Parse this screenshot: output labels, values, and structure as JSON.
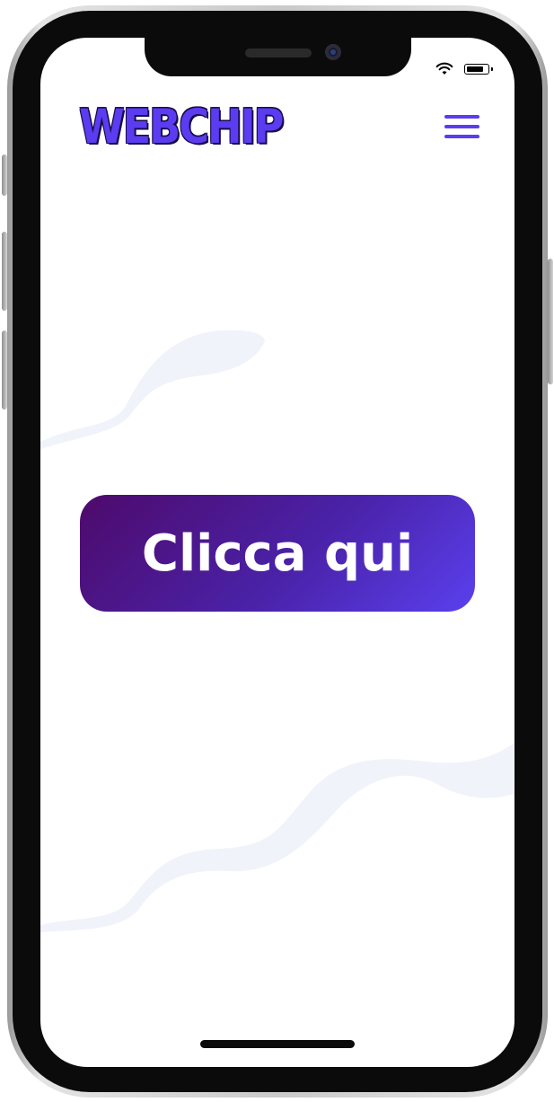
{
  "header": {
    "logo_text": "WEBCHIP"
  },
  "main": {
    "cta_label": "Clicca qui"
  },
  "status_bar": {
    "icons": [
      "wifi-icon",
      "battery-icon"
    ]
  },
  "colors": {
    "brand": "#5b3cf0",
    "button_gradient_start": "#4e0a6b",
    "button_gradient_end": "#5a40ee",
    "wave": "#f1f3fb"
  }
}
